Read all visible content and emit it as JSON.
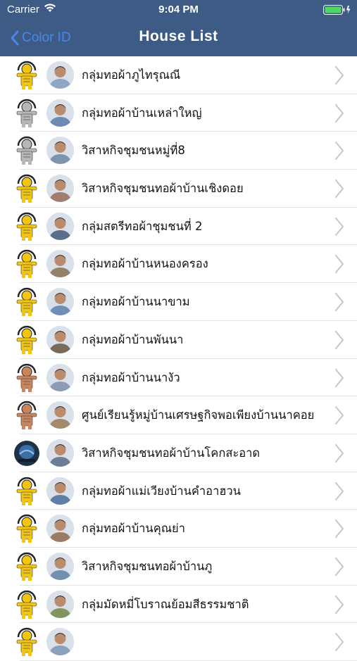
{
  "status": {
    "carrier": "Carrier",
    "time": "9:04 PM"
  },
  "nav": {
    "back_label": "Color ID",
    "title": "House List"
  },
  "colors": {
    "bar": "#3e5b86",
    "back": "#4a86e8",
    "gold": "#f2c511",
    "silver": "#b7b7b7",
    "bronze": "#c9855b",
    "navy": "#1f3147"
  },
  "rows": [
    {
      "label": "กลุ่มทอผ้าภูไทรุณณี",
      "badge": "gold"
    },
    {
      "label": "กลุ่มทอผ้าบ้านเหล่าใหญ่",
      "badge": "silver"
    },
    {
      "label": "วิสาหกิจชุมชนหมู่ที่8",
      "badge": "silver"
    },
    {
      "label": "วิสาหกิจชุมชนทอผ้าบ้านเชิงดอย",
      "badge": "gold"
    },
    {
      "label": "กลุ่มสตรีทอผ้าชุมชนที่ 2",
      "badge": "gold"
    },
    {
      "label": "กลุ่มทอผ้าบ้านหนองครอง",
      "badge": "gold"
    },
    {
      "label": "กลุ่มทอผ้าบ้านนาขาม",
      "badge": "gold"
    },
    {
      "label": "กลุ่มทอผ้าบ้านพันนา",
      "badge": "gold"
    },
    {
      "label": "กลุ่มทอผ้าบ้านนางัว",
      "badge": "bronze"
    },
    {
      "label": "ศูนย์เรียนรู้หมู่บ้านเศรษฐกิจพอเพียงบ้านนาคอย",
      "badge": "bronze"
    },
    {
      "label": "วิสาหกิจชุมชนทอผ้าบ้านโคกสะอาด",
      "badge": "navy"
    },
    {
      "label": "กลุ่มทอผ้าแม่เวียงบ้านคำอาฮวน",
      "badge": "gold"
    },
    {
      "label": "กลุ่มทอผ้าบ้านคุณย่า",
      "badge": "gold"
    },
    {
      "label": "วิสาหกิจชุมชนทอผ้าบ้านภู",
      "badge": "gold"
    },
    {
      "label": "กลุ่มมัดหมี่โบราณย้อมสีธรรมชาติ",
      "badge": "gold"
    },
    {
      "label": "",
      "badge": "gold"
    }
  ]
}
